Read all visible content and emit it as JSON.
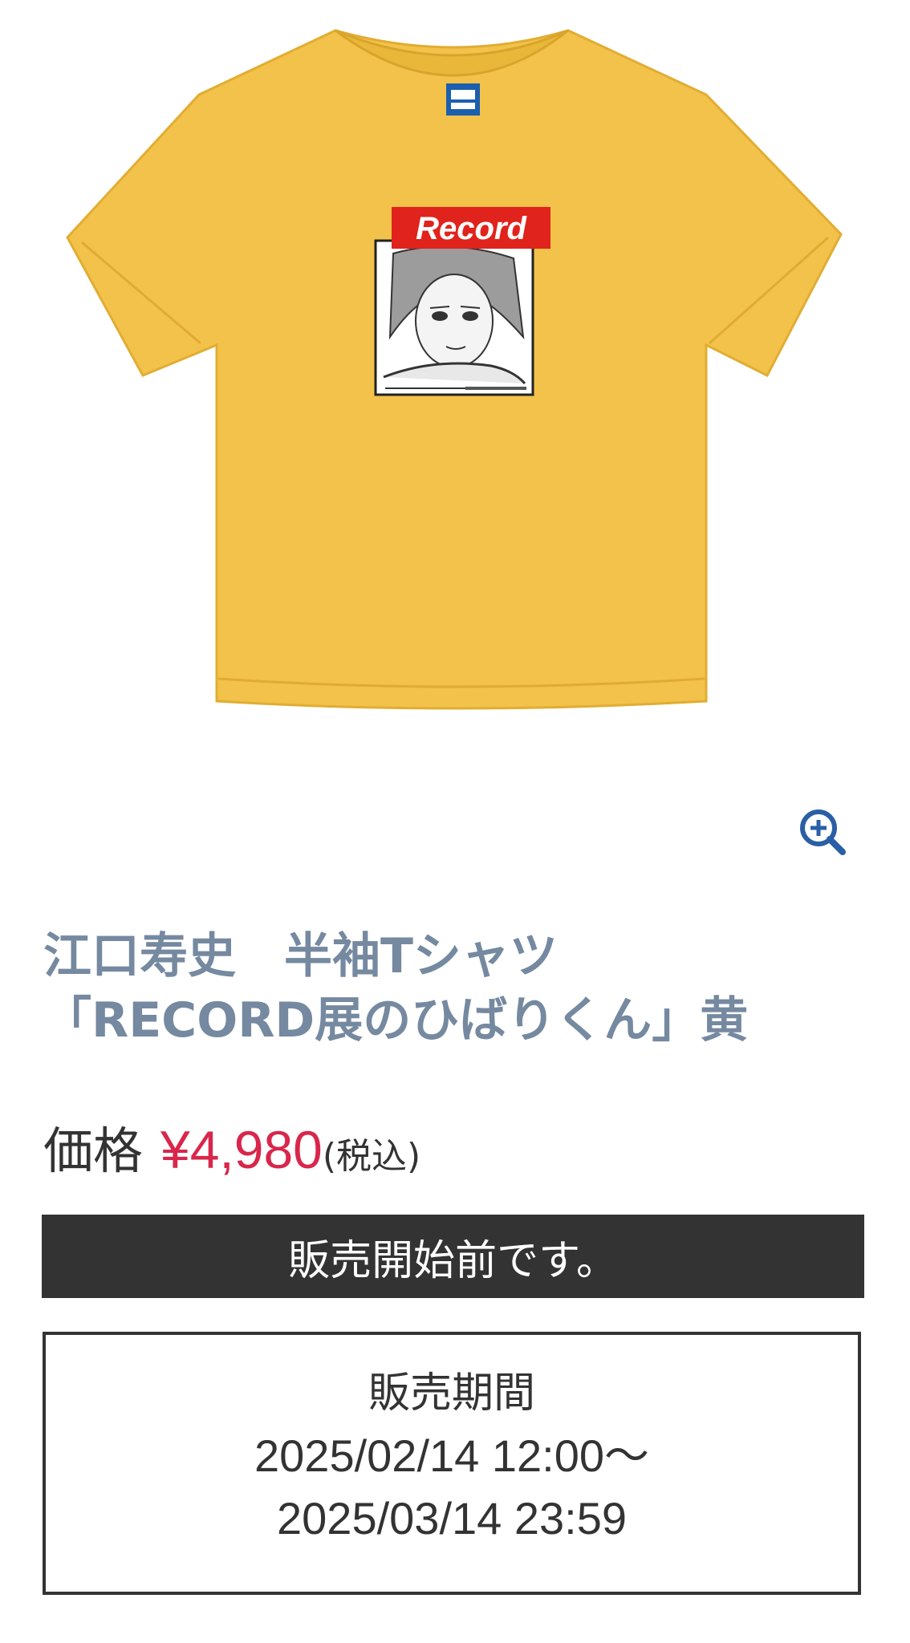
{
  "product": {
    "image": {
      "print_logo_text": "Record",
      "shirt_color": "#f3c24a",
      "logo_color": "#e0231c"
    },
    "zoom_icon": "zoom-in-icon",
    "title_line1": "江口寿史　半袖Tシャツ",
    "title_line2": "「RECORD展のひばりくん」黄",
    "price_label": "価格",
    "price_value": "¥4,980",
    "price_tax": "(税込)",
    "status": "販売開始前です。",
    "sales_period": {
      "heading": "販売期間",
      "start": "2025/02/14 12:00～",
      "end": "2025/03/14 23:59"
    }
  },
  "colors": {
    "title": "#7589a0",
    "price": "#d9264b",
    "status_bg": "#333333",
    "zoom_icon": "#2a5fa6"
  }
}
